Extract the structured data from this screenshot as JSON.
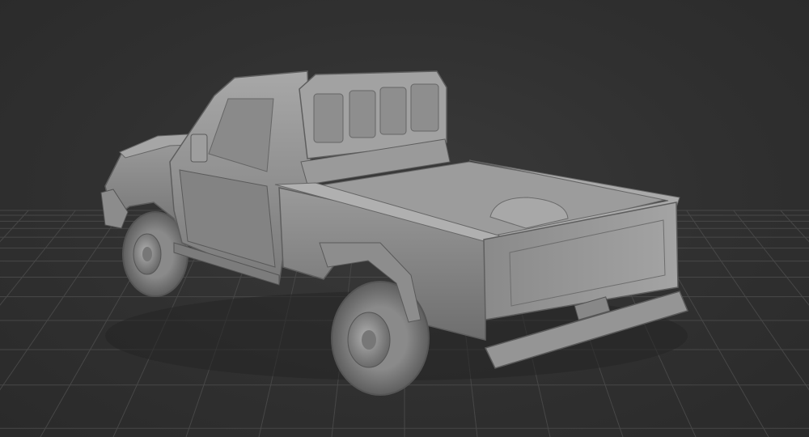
{
  "viewport": {
    "background_color": "#333333",
    "grid_color": "#474747"
  },
  "model": {
    "subject": "pickup-truck-3d-model",
    "material_color": "#8e8e8e",
    "shading": "clay-gray"
  }
}
